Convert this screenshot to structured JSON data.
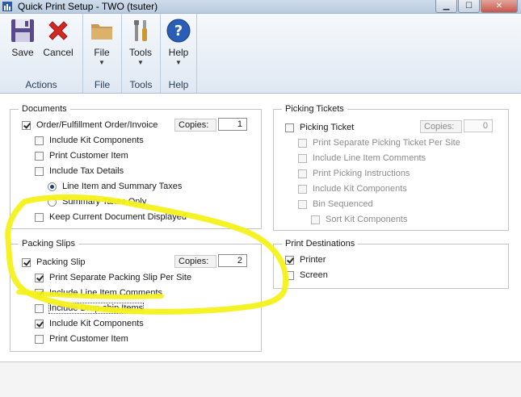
{
  "window": {
    "title": "Quick Print Setup  -  TWO (tsuter)",
    "controls": [
      "minimize",
      "maximize",
      "close"
    ]
  },
  "ribbon": {
    "groups": [
      {
        "label": "Actions",
        "buttons": [
          {
            "label": "Save",
            "icon": "save-icon"
          },
          {
            "label": "Cancel",
            "icon": "cancel-icon"
          }
        ]
      },
      {
        "label": "File",
        "buttons": [
          {
            "label": "File",
            "icon": "folder-icon",
            "dropdown": true
          }
        ]
      },
      {
        "label": "Tools",
        "buttons": [
          {
            "label": "Tools",
            "icon": "tools-icon",
            "dropdown": true
          }
        ]
      },
      {
        "label": "Help",
        "buttons": [
          {
            "label": "Help",
            "icon": "help-icon",
            "dropdown": true
          }
        ]
      }
    ],
    "dropdown_glyph": "▼"
  },
  "documents": {
    "legend": "Documents",
    "main_label": "Order/Fulfillment Order/Invoice",
    "main_checked": true,
    "copies_label": "Copies:",
    "copies_value": "1",
    "options": [
      {
        "label": "Include Kit Components",
        "checked": false
      },
      {
        "label": "Print Customer Item",
        "checked": false
      },
      {
        "label": "Include Tax Details",
        "checked": false
      }
    ],
    "tax_options": [
      {
        "label": "Line Item and Summary Taxes",
        "selected": true
      },
      {
        "label": "Summary Taxes Only",
        "selected": false
      }
    ],
    "keep_displayed_label": "Keep Current Document Displayed",
    "keep_displayed_checked": false
  },
  "packing_slips": {
    "legend": "Packing Slips",
    "main_label": "Packing Slip",
    "main_checked": true,
    "copies_label": "Copies:",
    "copies_value": "2",
    "options": [
      {
        "label": "Print Separate Packing Slip Per Site",
        "checked": true
      },
      {
        "label": "Include Line Item Comments",
        "checked": true
      },
      {
        "label": "Include Drop-ship Items",
        "checked": false
      },
      {
        "label": "Include Kit Components",
        "checked": true
      },
      {
        "label": "Print Customer Item",
        "checked": false
      }
    ]
  },
  "picking_tickets": {
    "legend": "Picking Tickets",
    "main_label": "Picking Ticket",
    "main_checked": false,
    "copies_label": "Copies:",
    "copies_value": "0",
    "options": [
      {
        "label": "Print Separate Picking Ticket Per Site",
        "checked": false
      },
      {
        "label": "Include Line Item Comments",
        "checked": false
      },
      {
        "label": "Print Picking Instructions",
        "checked": false
      },
      {
        "label": "Include Kit Components",
        "checked": false
      },
      {
        "label": "Bin Sequenced",
        "checked": false
      },
      {
        "label": "Sort Kit Components",
        "checked": false
      }
    ]
  },
  "print_destinations": {
    "legend": "Print Destinations",
    "options": [
      {
        "label": "Printer",
        "checked": true
      },
      {
        "label": "Screen",
        "checked": false
      }
    ]
  },
  "colors": {
    "highlight": "#f4f21a",
    "ribbon_label": "#2a3d57",
    "disabled_text": "#8c8c8c"
  }
}
